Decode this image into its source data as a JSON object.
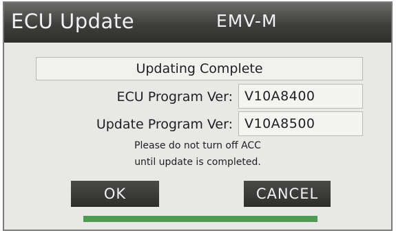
{
  "window": {
    "title": "ECU Update",
    "model": "EMV-M"
  },
  "status": {
    "message": "Updating Complete"
  },
  "fields": [
    {
      "label": "ECU Program Ver:",
      "value": "V10A8400"
    },
    {
      "label": "Update Program Ver:",
      "value": "V10A8500"
    }
  ],
  "notice": {
    "line1": "Please do not turn off ACC",
    "line2": "until update is completed."
  },
  "buttons": {
    "ok_label": "OK",
    "cancel_label": "CANCEL"
  },
  "progress": {
    "fraction": 1.0,
    "color": "#4f9a55"
  }
}
